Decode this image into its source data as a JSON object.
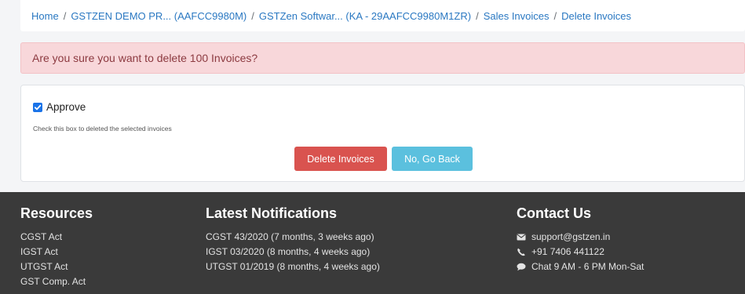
{
  "breadcrumb": [
    "Home",
    "GSTZEN DEMO PR... (AAFCC9980M)",
    "GSTZen Softwar... (KA - 29AAFCC9980M1ZR)",
    "Sales Invoices",
    "Delete Invoices"
  ],
  "alert": {
    "message": "Are you sure you want to delete 100 Invoices?"
  },
  "form": {
    "approve_label": "Approve",
    "approve_checked": true,
    "help_text": "Check this box to deleted the selected invoices",
    "delete_label": "Delete Invoices",
    "back_label": "No, Go Back"
  },
  "footer": {
    "resources": {
      "title": "Resources",
      "items": [
        "CGST Act",
        "IGST Act",
        "UTGST Act",
        "GST Comp. Act"
      ]
    },
    "notifications": {
      "title": "Latest Notifications",
      "items": [
        "CGST 43/2020 (7 months, 3 weeks ago)",
        "IGST 03/2020 (8 months, 4 weeks ago)",
        "UTGST 01/2019 (8 months, 4 weeks ago)"
      ]
    },
    "contact": {
      "title": "Contact Us",
      "email": "support@gstzen.in",
      "phone": "+91 7406 441122",
      "chat": "Chat 9 AM - 6 PM Mon-Sat"
    }
  },
  "colors": {
    "link": "#2a78c2",
    "alert_bg": "#f8d7da",
    "danger": "#d9534f",
    "info": "#5bc0de",
    "footer_bg": "#3a3a3a"
  }
}
